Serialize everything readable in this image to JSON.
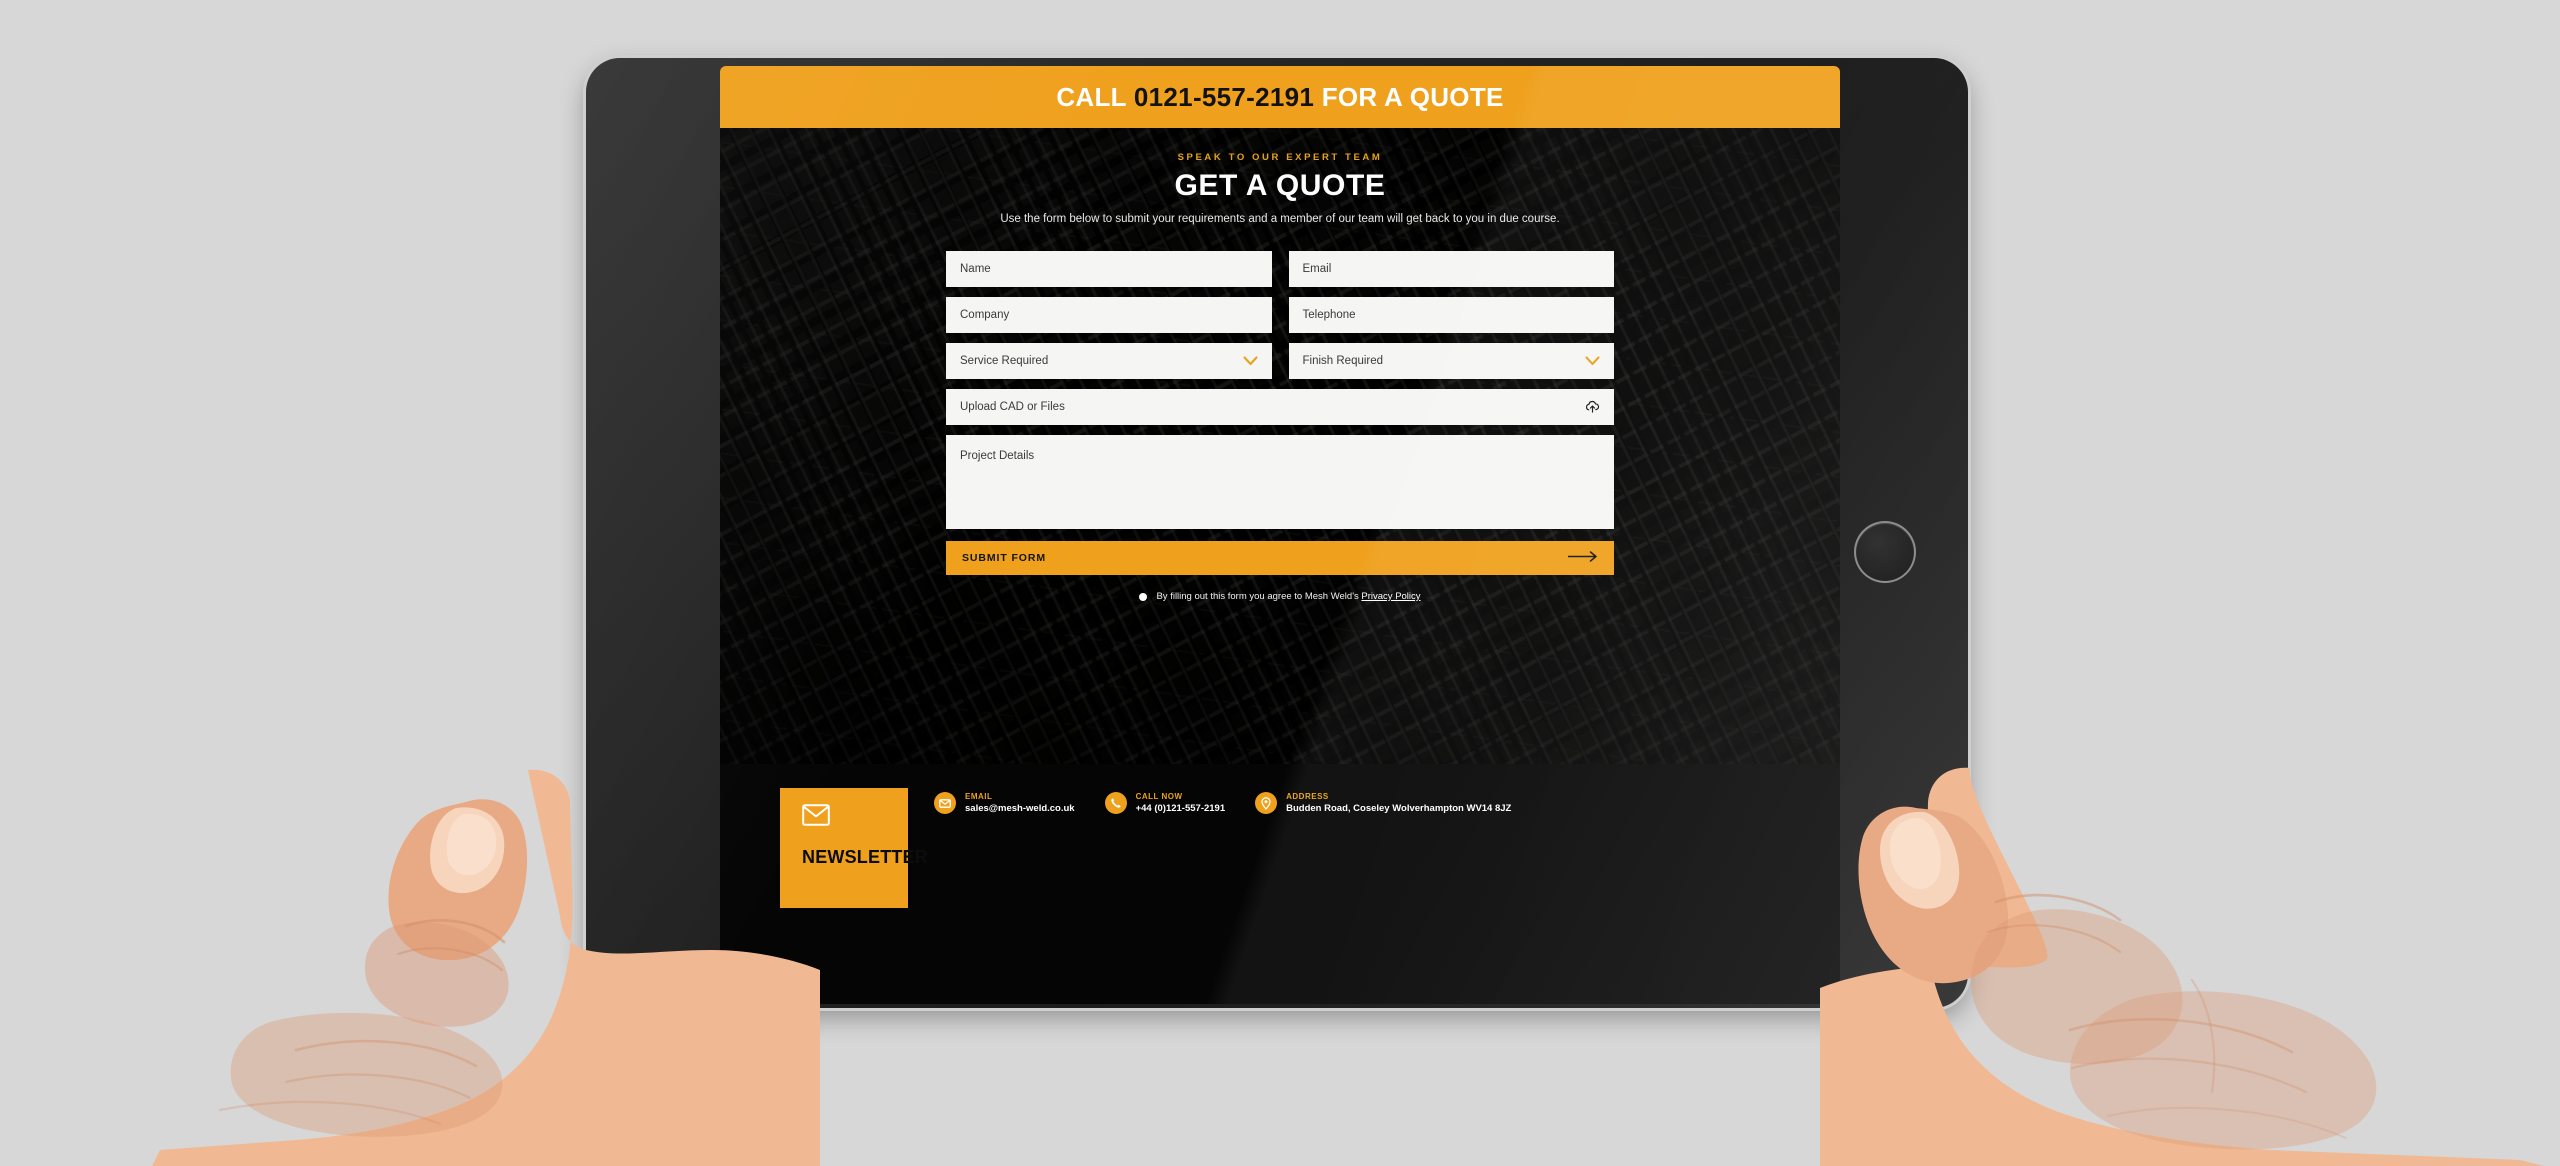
{
  "page": {
    "background_color": "#d7d7d7",
    "device": "tablet",
    "accent_color": "#efa01c",
    "dark_color": "#050505"
  },
  "cta_bar": {
    "prefix": "CALL",
    "phone": "0121-557-2191",
    "suffix": "FOR A QUOTE"
  },
  "quote": {
    "eyebrow": "SPEAK TO OUR EXPERT TEAM",
    "title": "GET A QUOTE",
    "subtitle": "Use the form below to submit your requirements and a member of our team will get back to you in due course."
  },
  "form": {
    "fields": [
      {
        "name": "name",
        "placeholder": "Name",
        "type": "text"
      },
      {
        "name": "email",
        "placeholder": "Email",
        "type": "text"
      },
      {
        "name": "company",
        "placeholder": "Company",
        "type": "text"
      },
      {
        "name": "telephone",
        "placeholder": "Telephone",
        "type": "text"
      },
      {
        "name": "service",
        "placeholder": "Service Required",
        "type": "select"
      },
      {
        "name": "finish",
        "placeholder": "Finish Required",
        "type": "select"
      },
      {
        "name": "upload",
        "placeholder": "Upload CAD or Files",
        "type": "file"
      },
      {
        "name": "details",
        "placeholder": "Project Details",
        "type": "textarea"
      }
    ],
    "submit_label": "SUBMIT FORM",
    "submit_icon": "arrow-right-icon",
    "consent_text": "By filling out this form you agree to Mesh Weld's",
    "consent_link": "Privacy Policy",
    "chevron_icon": "chevron-down-icon",
    "upload_icon": "cloud-upload-icon"
  },
  "footer": {
    "newsletter": {
      "icon": "envelope-icon",
      "title": "NEWSLETTER"
    },
    "contacts": [
      {
        "icon": "envelope-icon",
        "label": "EMAIL",
        "value": "sales@mesh-weld.co.uk"
      },
      {
        "icon": "phone-icon",
        "label": "CALL NOW",
        "value": "+44 (0)121-557-2191"
      },
      {
        "icon": "pin-icon",
        "label": "ADDRESS",
        "value": "Budden Road, Coseley Wolverhampton WV14 8JZ"
      }
    ]
  }
}
